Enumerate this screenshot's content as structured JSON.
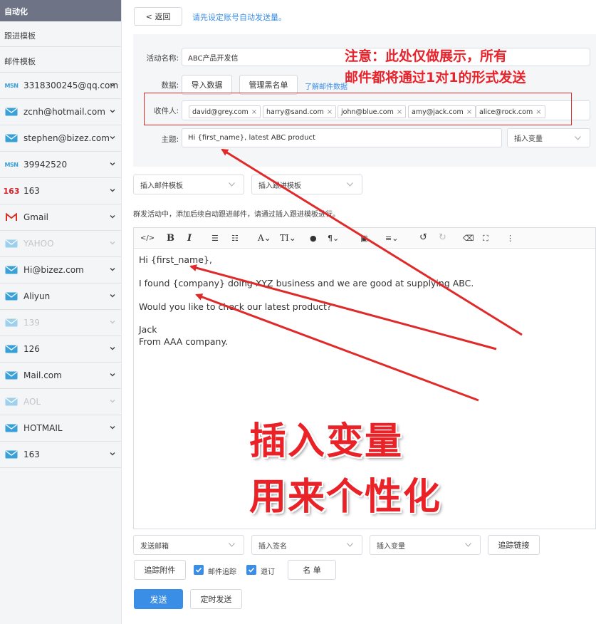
{
  "sidebar": {
    "header": "自动化",
    "items": [
      "跟进模板",
      "邮件模板"
    ],
    "accounts": [
      {
        "label": "3318300245@qq.com",
        "icon": "msn-icon",
        "disabled": false
      },
      {
        "label": "zcnh@hotmail.com",
        "icon": "envelope-icon",
        "disabled": false
      },
      {
        "label": "stephen@bizez.com",
        "icon": "envelope-icon",
        "disabled": false
      },
      {
        "label": "39942520",
        "icon": "msn-icon",
        "disabled": false
      },
      {
        "label": "163",
        "icon": "163-icon",
        "disabled": false
      },
      {
        "label": "Gmail",
        "icon": "gmail-icon",
        "disabled": false
      },
      {
        "label": "YAHOO",
        "icon": "envelope-icon",
        "disabled": true
      },
      {
        "label": "Hi@bizez.com",
        "icon": "envelope-icon",
        "disabled": false
      },
      {
        "label": "Aliyun",
        "icon": "envelope-icon",
        "disabled": false
      },
      {
        "label": "139",
        "icon": "envelope-icon",
        "disabled": true
      },
      {
        "label": "126",
        "icon": "envelope-icon",
        "disabled": false
      },
      {
        "label": "Mail.com",
        "icon": "envelope-icon",
        "disabled": false
      },
      {
        "label": "AOL",
        "icon": "envelope-icon",
        "disabled": true
      },
      {
        "label": "HOTMAIL",
        "icon": "envelope-icon",
        "disabled": false
      },
      {
        "label": "163",
        "icon": "envelope-icon",
        "disabled": false
      }
    ]
  },
  "header": {
    "back_label": "< 返回",
    "notice_link": "请先设定账号自动发送量。"
  },
  "form": {
    "campaign_label": "活动名称:",
    "campaign_value": "ABC产品开发信",
    "data_label": "数据:",
    "import_button": "导入数据",
    "blacklist_button": "管理黑名单",
    "learn_more_link": "了解邮件数据",
    "recipient_label": "收件人:",
    "recipients": [
      "david@grey.com",
      "harry@sand.com",
      "john@blue.com",
      "amy@jack.com",
      "alice@rock.com"
    ],
    "subject_label": "主题:",
    "subject_value": "Hi {first_name}, latest ABC product",
    "insert_variable": "插入变量"
  },
  "annotation_note": {
    "line1": "注意：此处仅做展示，所有",
    "line2": "邮件都将通过1对1的形式发送"
  },
  "templates": {
    "mail_template": "插入邮件模板",
    "followup_template": "插入跟进模板",
    "hint": "群发活动中，添加后续自动跟进邮件，请通过插入跟进模板进行。"
  },
  "editor": {
    "lines": [
      "Hi {first_name},",
      "I found {company} doing XYZ business and we are good at supplying ABC.",
      "Would you like to check our latest product?",
      "Jack",
      "From AAA company."
    ],
    "overlay_line1": "插入变量",
    "overlay_line2": "用来个性化"
  },
  "footer": {
    "send_mailbox": "发送邮箱",
    "insert_signature": "插入签名",
    "insert_variable": "插入变量",
    "track_link": "追踪链接",
    "track_attachment": "追踪附件",
    "mail_tracking": "邮件追踪",
    "mail_tracking_checked": true,
    "unsubscribe": "退订",
    "unsubscribe_checked": true,
    "list_button": "名 单",
    "send_button": "发送",
    "schedule_button": "定时发送"
  },
  "colors": {
    "accent": "#3a8ee6",
    "annotation_red": "#e8232b",
    "sidebar_header": "#6e7486"
  }
}
